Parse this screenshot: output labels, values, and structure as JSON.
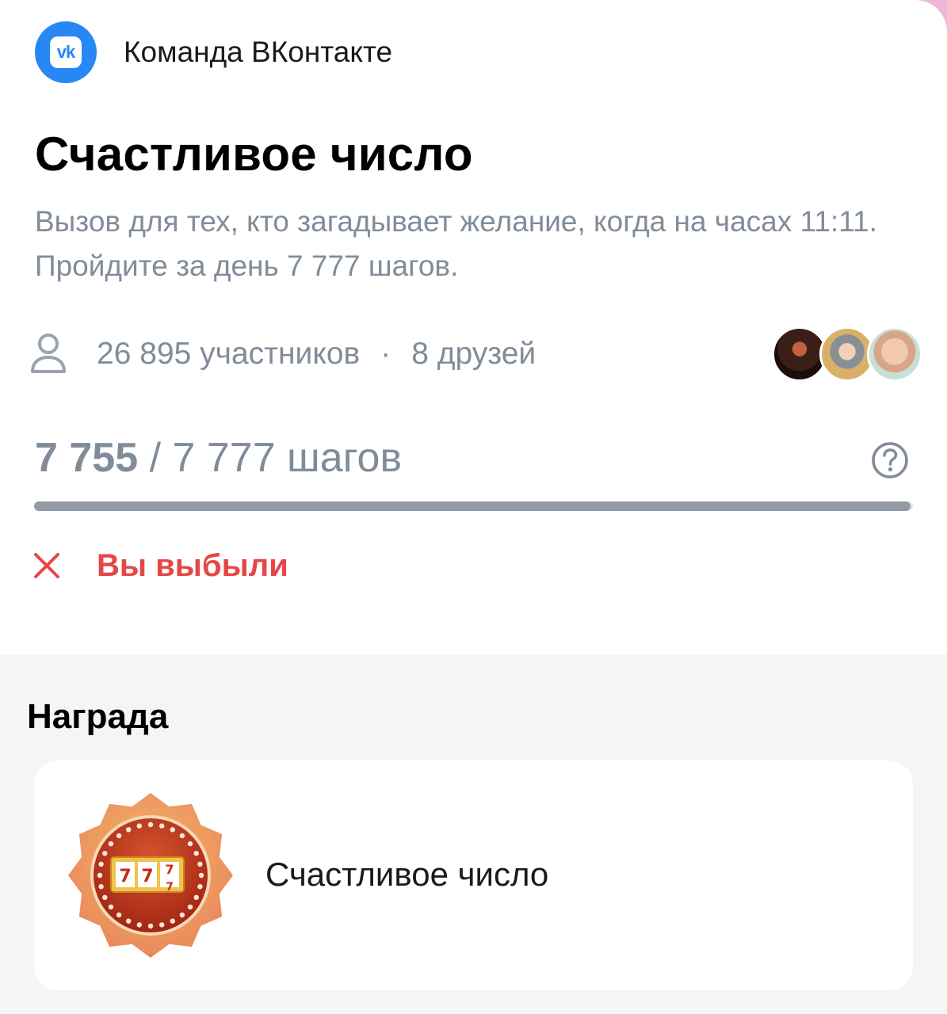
{
  "header": {
    "community_name": "Команда ВКонтакте",
    "logo_text": "vk"
  },
  "challenge": {
    "title": "Счастливое число",
    "description": "Вызов для тех, кто загадывает желание, когда на часах 11:11. Пройдите за день 7 777 шагов."
  },
  "stats": {
    "participants": "26 895 участников",
    "separator": "·",
    "friends": "8 друзей"
  },
  "progress": {
    "current": "7 755",
    "slash": " / ",
    "target": "7 777 шагов",
    "fraction": 0.997
  },
  "status": {
    "text": "Вы выбыли",
    "icon": "close-icon",
    "color": "#e64646"
  },
  "reward": {
    "heading": "Награда",
    "name": "Счастливое число",
    "badge_icon": "slot-machine-777-icon"
  },
  "colors": {
    "accent": "#2787f5",
    "secondary_text": "#818c99",
    "error": "#e64646"
  }
}
